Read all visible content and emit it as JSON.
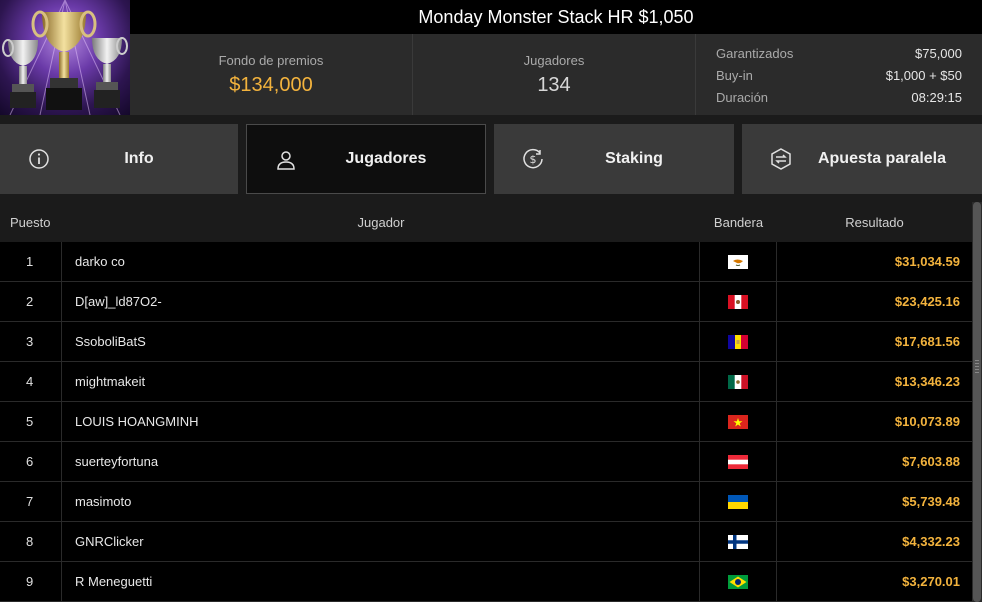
{
  "tournament": {
    "title": "Monday Monster Stack HR $1,050"
  },
  "summary": {
    "prize_label": "Fondo de premios",
    "prize_value": "$134,000",
    "players_label": "Jugadores",
    "players_value": "134",
    "details": [
      {
        "key": "Garantizados",
        "value": "$75,000"
      },
      {
        "key": "Buy-in",
        "value": "$1,000 + $50"
      },
      {
        "key": "Duración",
        "value": "08:29:15"
      }
    ]
  },
  "tabs": [
    {
      "label": "Info",
      "icon": "info-icon"
    },
    {
      "label": "Jugadores",
      "icon": "user-icon",
      "active": true
    },
    {
      "label": "Staking",
      "icon": "dollar-coin-icon"
    },
    {
      "label": "Apuesta paralela",
      "icon": "side-bet-icon"
    }
  ],
  "table": {
    "headers": {
      "position": "Puesto",
      "player": "Jugador",
      "flag": "Bandera",
      "result": "Resultado"
    },
    "rows": [
      {
        "position": "1",
        "player": "darko co",
        "flag": "cyprus",
        "result": "$31,034.59"
      },
      {
        "position": "2",
        "player": "D[aw]_ld87O2-",
        "flag": "peru",
        "result": "$23,425.16"
      },
      {
        "position": "3",
        "player": "SsoboliBatS",
        "flag": "andorra",
        "result": "$17,681.56"
      },
      {
        "position": "4",
        "player": "mightmakeit",
        "flag": "mexico",
        "result": "$13,346.23"
      },
      {
        "position": "5",
        "player": "LOUIS HOANGMINH",
        "flag": "vietnam",
        "result": "$10,073.89"
      },
      {
        "position": "6",
        "player": "suerteyfortuna",
        "flag": "austria",
        "result": "$7,603.88"
      },
      {
        "position": "7",
        "player": "masimoto",
        "flag": "ukraine",
        "result": "$5,739.48"
      },
      {
        "position": "8",
        "player": "GNRClicker",
        "flag": "finland",
        "result": "$4,332.23"
      },
      {
        "position": "9",
        "player": "R Meneguetti",
        "flag": "brazil",
        "result": "$3,270.01"
      }
    ]
  },
  "colors": {
    "accent_gold": "#f3b33d",
    "background": "#1b1b1b",
    "tab_bg": "#3a3a3a",
    "active_tab_bg": "#0e0e0e"
  }
}
